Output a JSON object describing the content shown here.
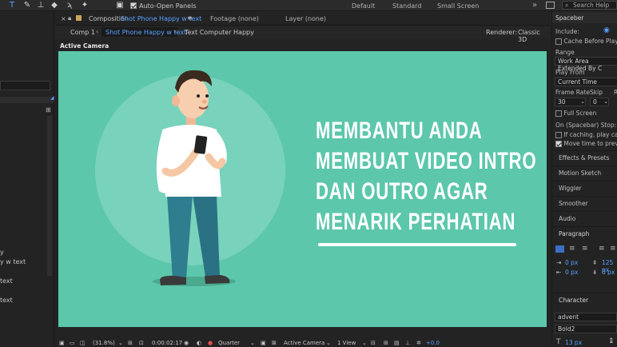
{
  "toolbar": {
    "auto_open_label": "Auto-Open Panels",
    "workspaces": [
      "Default",
      "Standard",
      "Small Screen"
    ],
    "search_placeholder": "Search Help",
    "more": "»"
  },
  "comp_header": {
    "composition_prefix": "Composition",
    "composition_name": "Shot Phone Happy w text",
    "menu": "≡",
    "footage": "Footage  (none)",
    "layer": "Layer  (none)"
  },
  "comp_nav": {
    "items": [
      "Comp 1",
      "Shot Phone Happy w text",
      "Text Computer Happy"
    ],
    "renderer_label": "Renderer:",
    "renderer_value": "Classic 3D"
  },
  "viewer": {
    "camera_label": "Active Camera",
    "headline": [
      "MEMBANTU ANDA",
      "MEMBUAT VIDEO INTRO",
      "DAN OUTRO AGAR",
      "MENARIK PERHATIAN"
    ],
    "bg_color": "#5cc7ab",
    "circle_color": "#79d2bb"
  },
  "viewer_bar": {
    "zoom": "(31.8%)",
    "timecode": "0:00:02:17",
    "resolution": "Quarter",
    "camera": "Active Camera",
    "views": "1 View",
    "exposure": "+0.0"
  },
  "left_panel": {
    "items": [
      "y",
      "y w text",
      "text",
      "text"
    ]
  },
  "right_panel": {
    "spacebar_title": "Spaceber",
    "include_label": "Include:",
    "cache_label": "Cache Before Playback",
    "range_label": "Range",
    "range_value": "Work Area Extended By C",
    "play_from_label": "Play From",
    "play_from_value": "Current Time",
    "frame_rate_label": "Frame Rate",
    "skip_label": "Skip",
    "r_label": "R",
    "frame_rate_value": "30",
    "skip_value": "0",
    "full_screen_label": "Full Screen",
    "stop_label": "On (Spacebar) Stop:",
    "if_caching_label": "If caching, play cached",
    "move_time_label": "Move time to preview t",
    "sections": [
      "Effects & Presets",
      "Motion Sketch",
      "Wiggler",
      "Smoother",
      "Audio"
    ],
    "paragraph_title": "Paragraph",
    "indent_values": [
      "0 px",
      "125 px",
      "0 px",
      "0 px"
    ],
    "character_title": "Character",
    "font_name": "advent",
    "font_style": "Bold2",
    "font_size": "13 px"
  }
}
